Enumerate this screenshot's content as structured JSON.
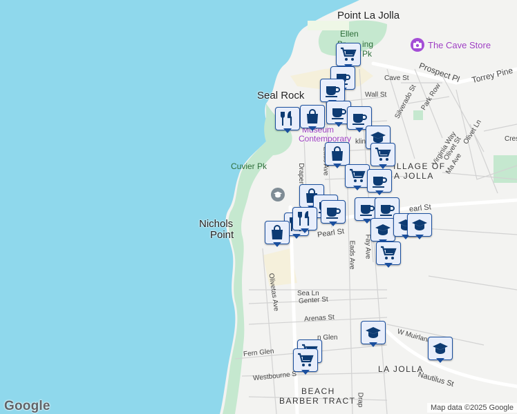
{
  "map": {
    "places": {
      "point_la_jolla": "Point La Jolla",
      "seal_rock": "Seal Rock",
      "nicholson_point_1": "Nichols",
      "nicholson_point_2": "Point",
      "village_1": "ILLAGE OF",
      "village_2": "A JOLLA",
      "la_jolla": "LA JOLLA",
      "beach": "BEACH",
      "barber_tract": "BARBER TRACT"
    },
    "parks": {
      "ellen": "Ellen",
      "browning_1": "Br",
      "browning_2": "ing",
      "scripps": "S",
      "scripps_pk": "Pk",
      "cuvier_pk": "Cuvier Pk"
    },
    "poi": {
      "cave_store": "The Cave Store",
      "museum_1": "Museum",
      "museum_2": "Contemporary"
    },
    "streets": {
      "prospect_pl": "Prospect Pl",
      "torrey_pines": "Torrey Pine",
      "cave_st": "Cave St",
      "wall_st": "Wall St",
      "silverado_st": "Silverado St",
      "park_row": "Park Row",
      "virginia_way": "Virginia Way",
      "olivet_st": "Olivet St",
      "olivet_ln": "Olivet Ln",
      "marine_ave": "Ma   Ave",
      "cresta": "Cres",
      "eads_ave": "Eads Ave",
      "eads_ave_2": "Eads Ave",
      "draper": "Draper",
      "pearl_st": "Pearl St",
      "pearl_st_2": "earl St",
      "fay_ave": "Fay Ave",
      "olivetas_ave": "Olivetas Ave",
      "sea_ln": "Sea Ln",
      "genter_st": "Genter St",
      "arenas_st": "Arenas St",
      "glen": "n Glen",
      "fern_glen": "Fern Glen",
      "w_muirlands": "W Muirland",
      "nautilus_st": "Nautilus St",
      "westbourne": "Westbourne S",
      "draper_2": "Drap",
      "klin": "klin"
    },
    "markers": [
      {
        "type": "shopping",
        "name": "marker-shopping-cart"
      },
      {
        "type": "cafe",
        "name": "marker-cafe"
      },
      {
        "type": "cafe",
        "name": "marker-cafe"
      },
      {
        "type": "restaurant",
        "name": "marker-restaurant"
      },
      {
        "type": "store",
        "name": "marker-store"
      },
      {
        "type": "cafe",
        "name": "marker-cafe"
      },
      {
        "type": "cafe",
        "name": "marker-cafe"
      },
      {
        "type": "school",
        "name": "marker-school"
      },
      {
        "type": "store",
        "name": "marker-store"
      },
      {
        "type": "shopping",
        "name": "marker-shopping-cart"
      },
      {
        "type": "shopping",
        "name": "marker-shopping-cart"
      },
      {
        "type": "cafe",
        "name": "marker-cafe"
      },
      {
        "type": "store",
        "name": "marker-store"
      },
      {
        "type": "cafe",
        "name": "marker-cafe"
      },
      {
        "type": "cafe",
        "name": "marker-cafe"
      },
      {
        "type": "cafe",
        "name": "marker-cafe"
      },
      {
        "type": "cafe",
        "name": "marker-cafe"
      },
      {
        "type": "restaurant",
        "name": "marker-restaurant"
      },
      {
        "type": "restaurant",
        "name": "marker-restaurant"
      },
      {
        "type": "store",
        "name": "marker-store"
      },
      {
        "type": "school",
        "name": "marker-school"
      },
      {
        "type": "school",
        "name": "marker-school"
      },
      {
        "type": "school",
        "name": "marker-school"
      },
      {
        "type": "shopping",
        "name": "marker-shopping-cart"
      },
      {
        "type": "school",
        "name": "marker-school"
      },
      {
        "type": "school",
        "name": "marker-school"
      },
      {
        "type": "shopping",
        "name": "marker-shopping-cart"
      },
      {
        "type": "shopping",
        "name": "marker-shopping-cart"
      }
    ],
    "colors": {
      "ocean": "#8fd8ec",
      "land": "#f3f3f1",
      "park": "#c5e8cf",
      "marker_border": "#1a4f9e",
      "marker_fill": "#e8eefb",
      "poi_purple": "#9c3cc0"
    }
  },
  "branding": {
    "logo": "Google",
    "attribution": "Map data ©2025 Google"
  }
}
